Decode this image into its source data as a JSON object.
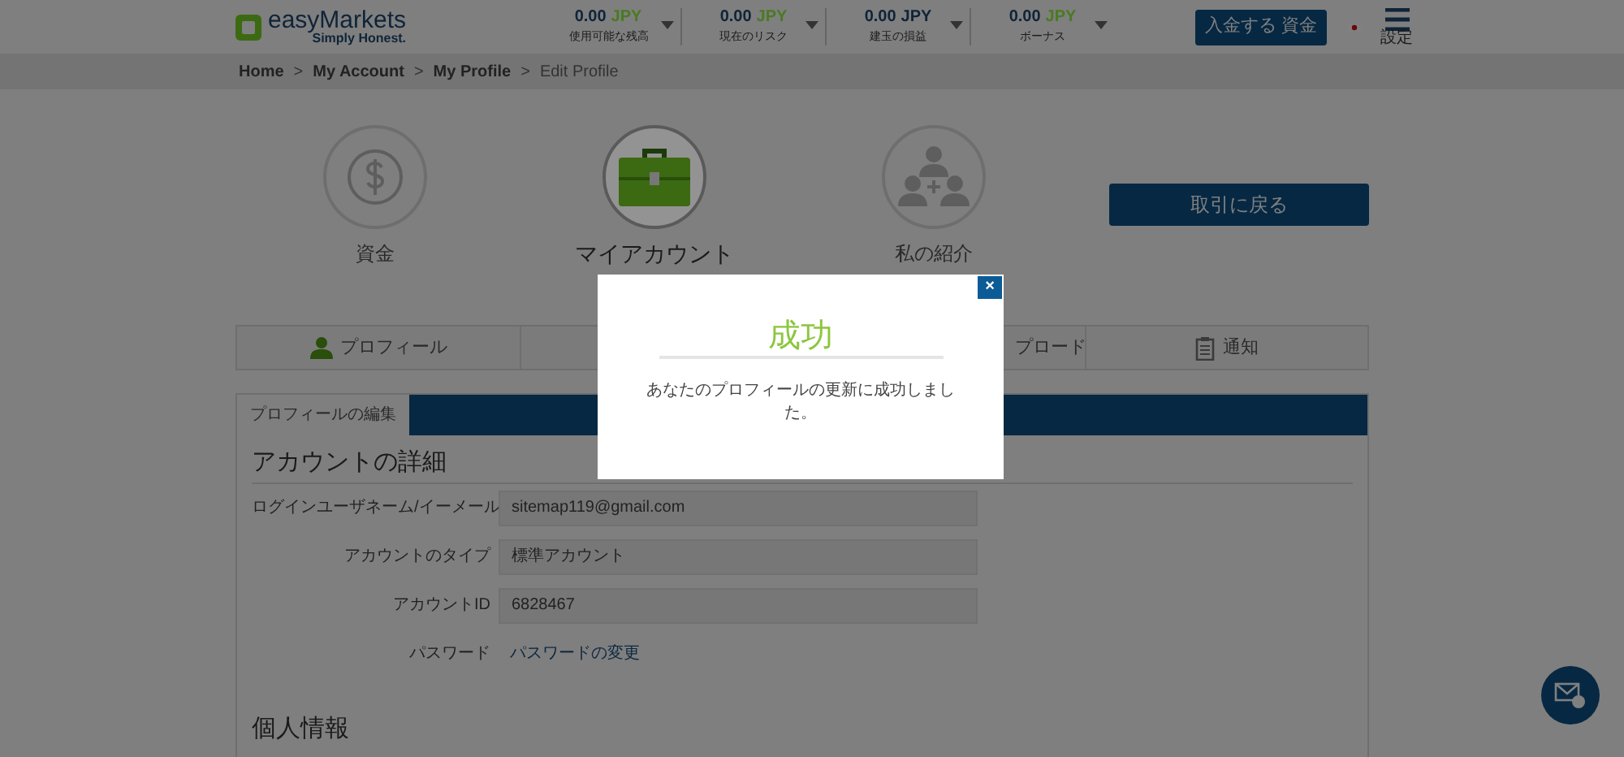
{
  "header": {
    "logo": {
      "name": "easyMarkets",
      "tagline": "Simply Honest."
    },
    "stats": [
      {
        "value": "0.00",
        "currency": "JPY",
        "color": "#4a7a22",
        "label": "使用可能な残高"
      },
      {
        "value": "0.00",
        "currency": "JPY",
        "color": "#4a7a22",
        "label": "現在のリスク"
      },
      {
        "value": "0.00",
        "currency": "JPY",
        "color": "#0f2438",
        "label": "建玉の損益"
      },
      {
        "value": "0.00",
        "currency": "JPY",
        "color": "#4a7a22",
        "label": "ボーナス"
      }
    ],
    "deposit_button": "入金する 資金",
    "menu_label": "設定"
  },
  "breadcrumb": [
    "Home",
    "My Account",
    "My Profile",
    "Edit Profile"
  ],
  "breadcrumb_separator": ">",
  "sections": [
    {
      "kind": "dollar",
      "label": "資金",
      "selected": false
    },
    {
      "kind": "briefcase",
      "label": "マイアカウント",
      "selected": true
    },
    {
      "kind": "people",
      "label": "私の紹介",
      "selected": false
    }
  ],
  "back_button": "取引に戻る",
  "tabs": [
    {
      "kind": "profile",
      "label": "プロフィール"
    },
    {
      "kind": "covered"
    },
    {
      "kind": "partial",
      "label": "プロード"
    },
    {
      "kind": "clipboard",
      "label": "通知"
    }
  ],
  "panel": {
    "tab": "プロフィールの編集",
    "heading": "アカウントの詳細",
    "rows": [
      {
        "kind": "field",
        "label": "ログインユーザネーム/イーメール",
        "value": "sitemap119@gmail.com"
      },
      {
        "kind": "field",
        "label": "アカウントのタイプ",
        "value": "標準アカウント"
      },
      {
        "kind": "field",
        "label": "アカウントID",
        "value": "6828467"
      },
      {
        "kind": "link",
        "label": "パスワード",
        "value": "パスワードの変更"
      }
    ],
    "next_heading": "個人情報"
  },
  "modal": {
    "close": "×",
    "title": "成功",
    "message": "あなたのプロフィールの更新に成功しました。"
  }
}
